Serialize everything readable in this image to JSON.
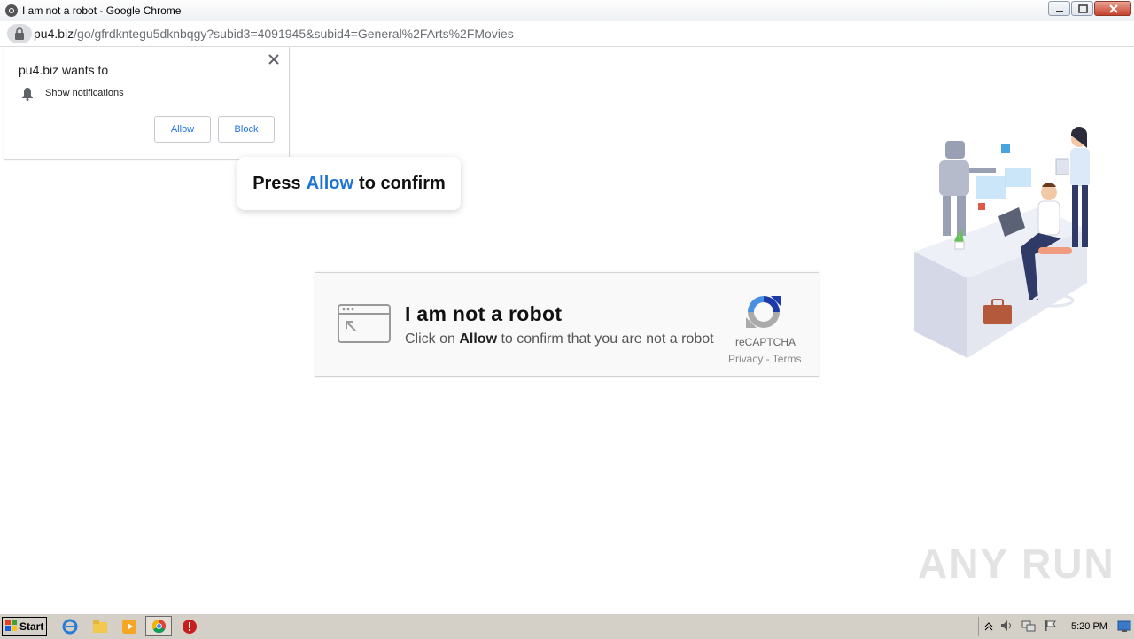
{
  "window": {
    "title": "I am not a robot - Google Chrome"
  },
  "address": {
    "host": "pu4.biz",
    "path": "/go/gfrdkntegu5dknbqgy?subid3=4091945&subid4=General%2FArts%2FMovies"
  },
  "permission_prompt": {
    "origin_text": "pu4.biz wants to",
    "item": "Show notifications",
    "allow_label": "Allow",
    "block_label": "Block"
  },
  "press_bubble": {
    "prefix": "Press",
    "highlight": "Allow",
    "suffix": "to confirm"
  },
  "captcha": {
    "heading": "I am not a robot",
    "sub_prefix": "Click on",
    "sub_bold": "Allow",
    "sub_suffix": "to confirm that you are not a robot",
    "brand": "reCAPTCHA",
    "links": "Privacy - Terms"
  },
  "watermark": "ANY RUN",
  "taskbar": {
    "start_label": "Start",
    "clock": "5:20 PM"
  },
  "colors": {
    "accent_blue": "#1e74d2",
    "chrome_link": "#1a73e8"
  }
}
